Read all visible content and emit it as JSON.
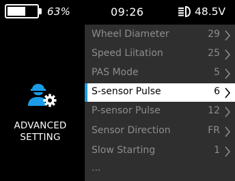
{
  "status": {
    "battery_percent": "63%",
    "battery_level": 0.63,
    "time": "09:26",
    "voltage": "48.5V",
    "headlight_icon": "headlight-icon"
  },
  "sidebar": {
    "icon": "user-settings-icon",
    "title_line1": "ADVANCED",
    "title_line2": "SETTING"
  },
  "menu": {
    "items": [
      {
        "label": "Wheel Diameter",
        "value": "29",
        "selected": false
      },
      {
        "label": "Speed Liitation",
        "value": "25",
        "selected": false
      },
      {
        "label": "PAS Mode",
        "value": "5",
        "selected": false
      },
      {
        "label": "S-sensor Pulse",
        "value": "6",
        "selected": true
      },
      {
        "label": "P-sensor Pulse",
        "value": "12",
        "selected": false
      },
      {
        "label": "Sensor Direction",
        "value": "FR",
        "selected": false
      },
      {
        "label": "Slow Starting",
        "value": "1",
        "selected": false
      }
    ],
    "more": "..."
  },
  "colors": {
    "background": "#000000",
    "menu_bg": "#2f2f2f",
    "accent": "#1b9ce8",
    "dim_text": "#8d8d8d"
  }
}
